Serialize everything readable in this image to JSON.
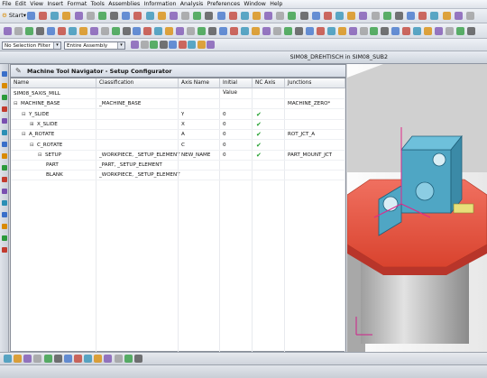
{
  "menubar": {
    "items": [
      "File",
      "Edit",
      "View",
      "Insert",
      "Format",
      "Tools",
      "Assemblies",
      "Information",
      "Analysis",
      "Preferences",
      "Window",
      "Help"
    ]
  },
  "toolbar": {
    "start_label": "Start"
  },
  "selection": {
    "filter_value": "No Selection Filter",
    "scope_value": "Entire Assembly"
  },
  "viewport": {
    "title": "SIM08_DREHTISCH in SIM08_SUB2"
  },
  "navigator": {
    "title": "Machine Tool Navigator - Setup Configurator",
    "columns": [
      "Name",
      "Classification",
      "Axis Name",
      "Initial Value",
      "NC Axis",
      "Junctions"
    ],
    "rows": [
      {
        "expander": "",
        "name": "SIM08_5AXIS_MILL",
        "classification": "",
        "axis": "",
        "initial": "",
        "nc": false,
        "junction": "",
        "indent": 0
      },
      {
        "expander": "⊟",
        "name": "MACHINE_BASE",
        "classification": "_MACHINE_BASE",
        "axis": "",
        "initial": "",
        "nc": false,
        "junction": "MACHINE_ZERO*",
        "indent": 0
      },
      {
        "expander": "⊟",
        "name": "Y_SLIDE",
        "classification": "",
        "axis": "Y",
        "initial": "0",
        "nc": true,
        "junction": "",
        "indent": 1
      },
      {
        "expander": "⊞",
        "name": "X_SLIDE",
        "classification": "",
        "axis": "X",
        "initial": "0",
        "nc": true,
        "junction": "",
        "indent": 2
      },
      {
        "expander": "⊟",
        "name": "A_ROTATE",
        "classification": "",
        "axis": "A",
        "initial": "0",
        "nc": true,
        "junction": "ROT_JCT_A",
        "indent": 1
      },
      {
        "expander": "⊟",
        "name": "C_ROTATE",
        "classification": "",
        "axis": "C",
        "initial": "0",
        "nc": true,
        "junction": "",
        "indent": 2
      },
      {
        "expander": "⊟",
        "name": "SETUP",
        "classification": "_WORKPIECE, _SETUP_ELEMENT",
        "axis": "NEW_NAME",
        "initial": "0",
        "nc": true,
        "junction": "PART_MOUNT_JCT",
        "indent": 3
      },
      {
        "expander": "",
        "name": "PART",
        "classification": "_PART, _SETUP_ELEMENT",
        "axis": "",
        "initial": "",
        "nc": false,
        "junction": "",
        "indent": 4
      },
      {
        "expander": "",
        "name": "BLANK",
        "classification": "_WORKPIECE, _SETUP_ELEMENT",
        "axis": "",
        "initial": "",
        "nc": false,
        "junction": "",
        "indent": 4
      }
    ]
  },
  "colors": {
    "accent_red": "#e8503a",
    "model_teal": "#4fa6c4",
    "check_green": "#1e9e2a"
  }
}
